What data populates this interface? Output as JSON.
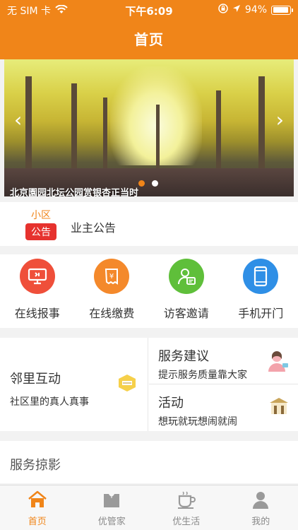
{
  "status_bar": {
    "carrier": "无 SIM 卡",
    "time": "下午6:09",
    "battery": "94%",
    "battery_level": 0.94
  },
  "header": {
    "title": "首页"
  },
  "banner": {
    "caption": "北京園园北坛公园赏银杏正当时",
    "prev_icon": "chevron-left-icon",
    "next_icon": "chevron-right-icon",
    "slide_count": 2,
    "active_slide": 1
  },
  "notice": {
    "badge_top": "小区",
    "badge_bottom": "公告",
    "label": "业主公告"
  },
  "actions": [
    {
      "label": "在线报事",
      "icon": "monitor-icon",
      "color": "#ef4f3a"
    },
    {
      "label": "在线缴费",
      "icon": "bill-icon",
      "color": "#f4892b"
    },
    {
      "label": "访客邀请",
      "icon": "visitor-card-icon",
      "color": "#5fbf3a"
    },
    {
      "label": "手机开门",
      "icon": "phone-icon",
      "color": "#2f8fe6"
    }
  ],
  "features": {
    "left": {
      "title": "邻里互动",
      "subtitle": "社区里的真人真事"
    },
    "right_top": {
      "title": "服务建议",
      "subtitle": "提示服务质量靠大家"
    },
    "right_bottom": {
      "title": "活动",
      "subtitle": "想玩就玩想闹就闹"
    }
  },
  "section": {
    "title": "服务掠影"
  },
  "tabbar": {
    "tabs": [
      {
        "label": "首页",
        "icon": "home-icon",
        "active": true
      },
      {
        "label": "优管家",
        "icon": "butler-icon",
        "active": false
      },
      {
        "label": "优生活",
        "icon": "coffee-cup-icon",
        "active": false
      },
      {
        "label": "我的",
        "icon": "person-icon",
        "active": false
      }
    ]
  },
  "colors": {
    "accent": "#f08519",
    "notice_red": "#e6322e"
  }
}
